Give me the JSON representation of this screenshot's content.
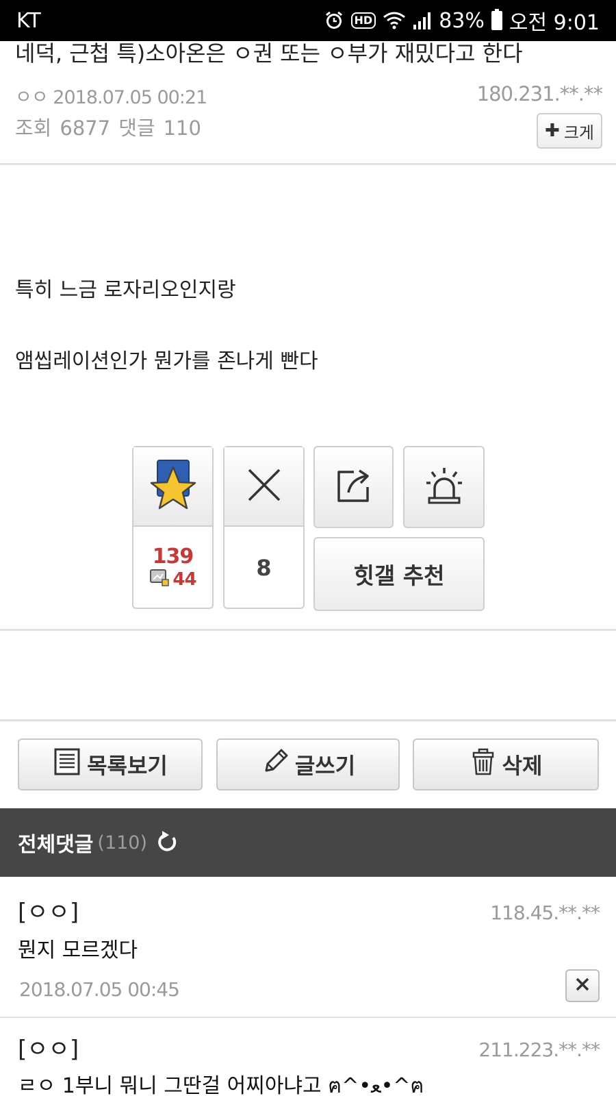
{
  "status_bar": {
    "carrier": "KT",
    "battery": "83%",
    "time": "오전 9:01",
    "hd_badge": "HD",
    "icons": [
      "alarm-icon",
      "hd-voice-icon",
      "wifi-icon",
      "signal-icon",
      "battery-icon"
    ]
  },
  "post": {
    "title": "네덕, 근첩 특)소아온은 ㅇ권 또는 ㅇ부가 재밌다고 한다",
    "author": "ㅇㅇ",
    "date": "2018.07.05 00:21",
    "ip": "180.231.**.**",
    "views_label": "조회",
    "views": "6877",
    "comments_label": "댓글",
    "comments": "110",
    "enlarge_label": "크게",
    "body_lines": [
      "특히 느금 로자리오인지랑",
      "앰씹레이션인가 뭔가를 존나게 빤다"
    ]
  },
  "reactions": {
    "recommend_count": "139",
    "mobile_recommend_count": "44",
    "not_recommend_count": "8",
    "hit_label": "힛갤 추천",
    "icons": [
      "star-recommend-icon",
      "x-not-recommend-icon",
      "share-icon",
      "report-siren-icon",
      "mobile-icon"
    ]
  },
  "actions": {
    "list_label": "목록보기",
    "write_label": "글쓰기",
    "delete_label": "삭제"
  },
  "comment_section": {
    "title": "전체댓글",
    "count": "(110)"
  },
  "comments": [
    {
      "name": "[ㅇㅇ]",
      "ip": "118.45.**.**",
      "text": "뭔지 모르겠다",
      "date": "2018.07.05 00:45"
    },
    {
      "name": "[ㅇㅇ]",
      "ip": "211.223.**.**",
      "text": "ㄹㅇ 1부니 뭐니 그딴걸 어찌아냐고 ฅ^•ﻌ•^ฅ"
    }
  ],
  "colors": {
    "accent_red": "#c33a3a",
    "comment_header_bg": "#464646",
    "meta_gray": "#9a9a9a"
  }
}
